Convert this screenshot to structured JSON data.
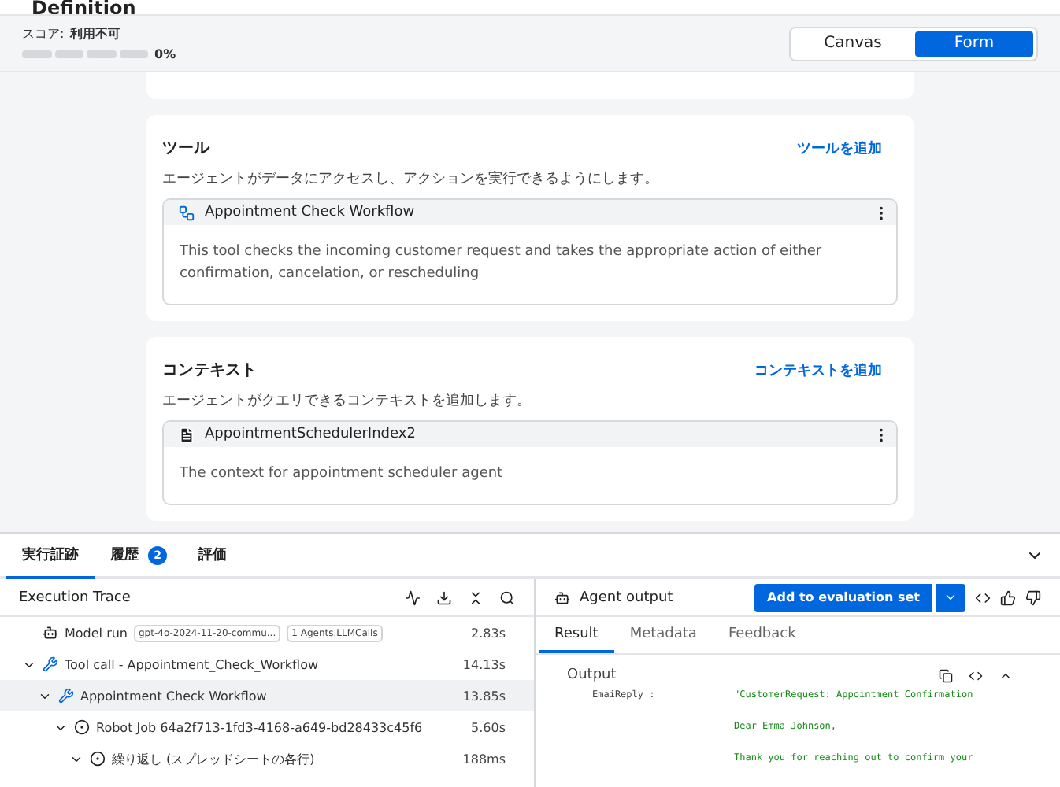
{
  "header": {
    "title": "Definition"
  },
  "score": {
    "label": "スコア:",
    "value": "利用不可",
    "level": 0,
    "percent": "0%"
  },
  "view_toggle": [
    {
      "label": "Canvas",
      "selected": false
    },
    {
      "label": "Form",
      "selected": true
    }
  ],
  "sections": [
    {
      "title": "ツール",
      "action": "ツールを追加",
      "description": "エージェントがデータにアクセスし、アクションを実行できるようにします。",
      "item": {
        "kind": "tool",
        "name": "Appointment Check Workflow",
        "text": "This tool checks the incoming customer request and takes the appropriate action of either confirmation, cancelation, or rescheduling"
      }
    },
    {
      "title": "コンテキスト",
      "action": "コンテキストを追加",
      "description": "エージェントがクエリできるコンテキストを追加します。",
      "item": {
        "kind": "context",
        "name": "AppointmentSchedulerIndex2",
        "text": "The context for appointment scheduler agent"
      }
    }
  ],
  "bottom_tabs": [
    {
      "label": "実行証跡",
      "selected": true
    },
    {
      "label": "履歴",
      "selected": false,
      "badge": "2"
    },
    {
      "label": "評価",
      "selected": false
    }
  ],
  "trace": {
    "title": "Execution Trace",
    "rows": [
      {
        "kind": "model",
        "label": "Model run",
        "tags": [
          "gpt-4o-2024-11-20-commu...",
          "1 Agents.LLMCalls"
        ],
        "time": "2.83s",
        "selected": false
      },
      {
        "kind": "tool",
        "label": "Tool call - Appointment_Check_Workflow",
        "time": "14.13s",
        "selected": false,
        "expanded": true,
        "children": [
          {
            "kind": "tool",
            "label": "Appointment Check Workflow",
            "time": "13.85s",
            "selected": true,
            "expanded": true,
            "children": [
              {
                "kind": "job",
                "label": "Robot Job 64a2f713-1fd3-4168-a649-bd28433c45f6",
                "time": "5.60s",
                "selected": false,
                "expanded": true,
                "children": [
                  {
                    "kind": "job",
                    "label": "繰り返し (スプレッドシートの各行)",
                    "time": "188ms",
                    "selected": false,
                    "expanded": true
                  }
                ]
              }
            ]
          }
        ]
      }
    ]
  },
  "output_panel": {
    "title": "Agent output",
    "primary_button": "Add to evaluation set",
    "tabs": [
      {
        "label": "Result",
        "selected": true
      },
      {
        "label": "Metadata",
        "selected": false
      },
      {
        "label": "Feedback",
        "selected": false
      }
    ],
    "section_title": "Output",
    "field": {
      "name": "EmaiReply :",
      "lines": [
        "\"CustomerRequest: Appointment Confirmation",
        "Dear Emma Johnson,",
        "Thank you for reaching out to confirm your"
      ]
    }
  }
}
